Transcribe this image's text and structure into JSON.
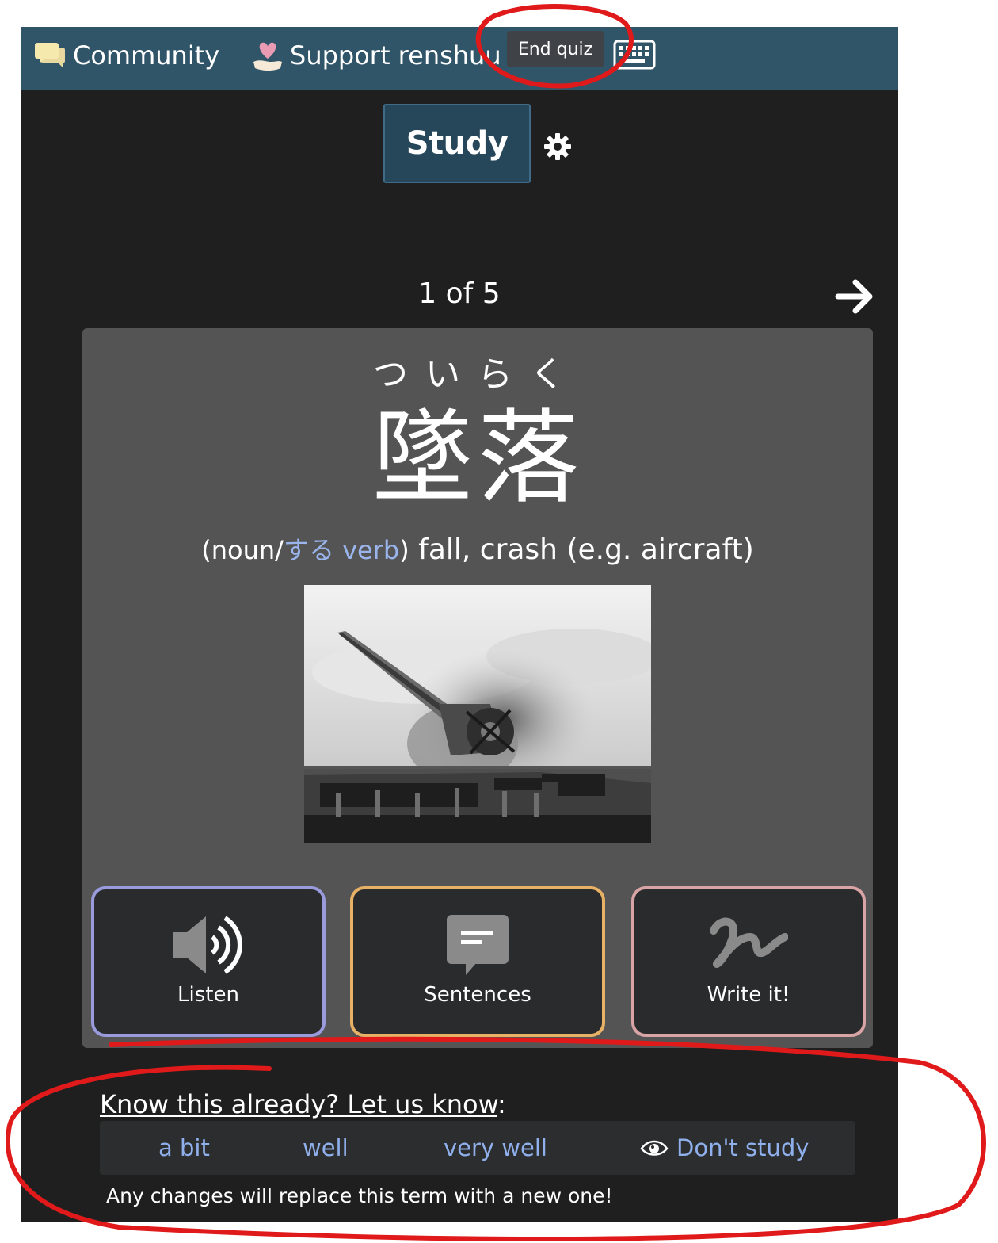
{
  "nav": {
    "community_label": "Community",
    "support_label": "Support renshuu",
    "end_quiz_label": "End quiz"
  },
  "study": {
    "tab_label": "Study",
    "counter": "1 of 5"
  },
  "card": {
    "furigana": "ついらく",
    "kanji": "墜落",
    "pos_open": "(noun/",
    "pos_link": "する verb",
    "pos_close": ")",
    "meaning": " fall, crash (e.g. aircraft)"
  },
  "actions": {
    "listen_label": "Listen",
    "sentences_label": "Sentences",
    "write_label": "Write it!"
  },
  "know": {
    "heading": "Know this already? Let us know",
    "colon": ":",
    "options": [
      "a bit",
      "well",
      "very well",
      "Don't study"
    ],
    "note": "Any changes will replace this term with a new one!"
  },
  "colors": {
    "navbar": "#305569",
    "page_bg": "#1f1f1f",
    "card_bg": "#545454",
    "listen_border": "#9a9bdd",
    "sentences_border": "#e8b266",
    "write_border": "#d9a4a6",
    "link": "#8fb0ec",
    "annotation": "#e01a1a"
  }
}
